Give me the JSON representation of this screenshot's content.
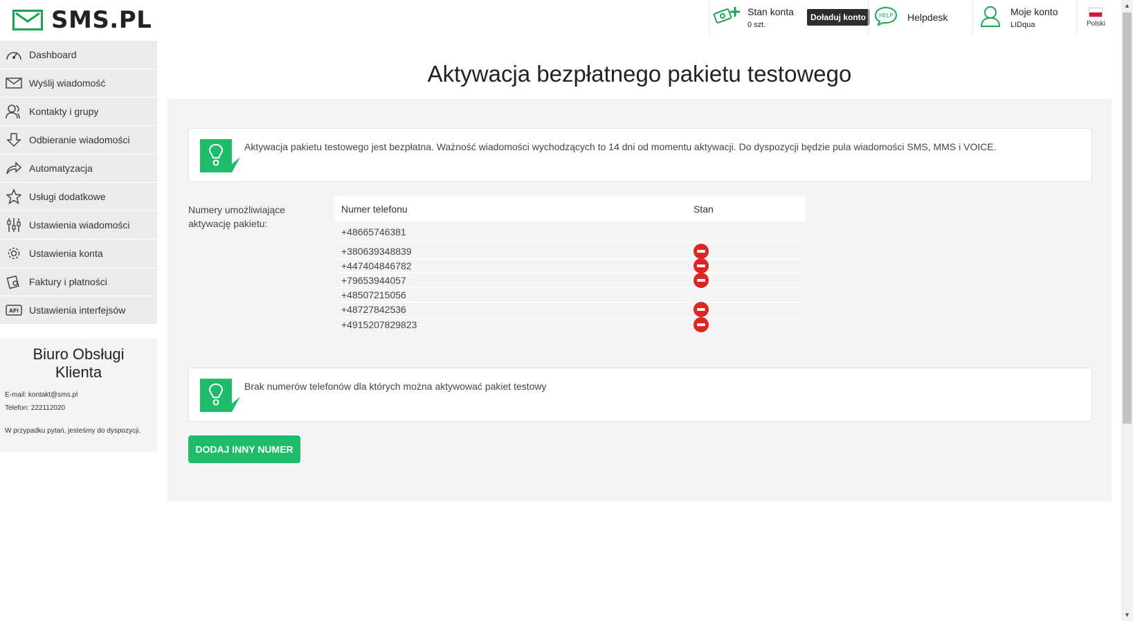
{
  "brand": {
    "name": "SMS.PL"
  },
  "header": {
    "account_status_title": "Stan konta",
    "account_status_value": "0 szt.",
    "topup_label": "Doładuj konto",
    "helpdesk_label": "Helpdesk",
    "help_icon_text": "HELP",
    "my_account_title": "Moje konto",
    "my_account_user": "LIDqua",
    "language": "Polski"
  },
  "sidebar": {
    "items": [
      {
        "label": "Dashboard",
        "icon": "dashboard-icon"
      },
      {
        "label": "Wyślij wiadomość",
        "icon": "envelope-icon"
      },
      {
        "label": "Kontakty i grupy",
        "icon": "contacts-icon"
      },
      {
        "label": "Odbieranie wiadomości",
        "icon": "download-arrow-icon"
      },
      {
        "label": "Automatyzacja",
        "icon": "forward-arrow-icon"
      },
      {
        "label": "Usługi dodatkowe",
        "icon": "star-icon"
      },
      {
        "label": "Ustawienia wiadomości",
        "icon": "sliders-icon"
      },
      {
        "label": "Ustawienia konta",
        "icon": "gear-icon"
      },
      {
        "label": "Faktury i płatności",
        "icon": "invoice-icon"
      },
      {
        "label": "Ustawienia interfejsów",
        "icon": "api-icon",
        "icon_text": "API"
      }
    ],
    "support": {
      "title_line1": "Biuro Obsługi",
      "title_line2": "Klienta",
      "email": "E-mail: kontakt@sms.pl",
      "phone": "Telefon: 222112020",
      "note": "W przypadku pytań, jesteśmy do dyspozycji."
    }
  },
  "main": {
    "title": "Aktywacja bezpłatnego pakietu testowego",
    "info_text": "Aktywacja pakietu testowego jest bezpłatna. Ważność wiadomości wychodzących to 14 dni od momentu aktywacji. Do dyspozycji będzie pula wiadomości SMS, MMS i VOICE.",
    "numbers_label": "Numery umożliwiające aktywację pakietu:",
    "table": {
      "headers": {
        "number": "Numer telefonu",
        "status": "Stan"
      },
      "rows": [
        {
          "number": "+48665746381",
          "blocked": false
        },
        {
          "number": "+380639348839",
          "blocked": true
        },
        {
          "number": "+447404846782",
          "blocked": true
        },
        {
          "number": "+79653944057",
          "blocked": true
        },
        {
          "number": "+48507215056",
          "blocked": false
        },
        {
          "number": "+48727842536",
          "blocked": true
        },
        {
          "number": "+4915207829823",
          "blocked": true
        }
      ]
    },
    "no_numbers_text": "Brak numerów telefonów dla których można aktywować pakiet testowy",
    "add_number_label": "DODAJ INNY NUMER"
  },
  "colors": {
    "brand_green": "#1aa551",
    "button_green": "#1dbb6a",
    "danger_red": "#e02424"
  }
}
